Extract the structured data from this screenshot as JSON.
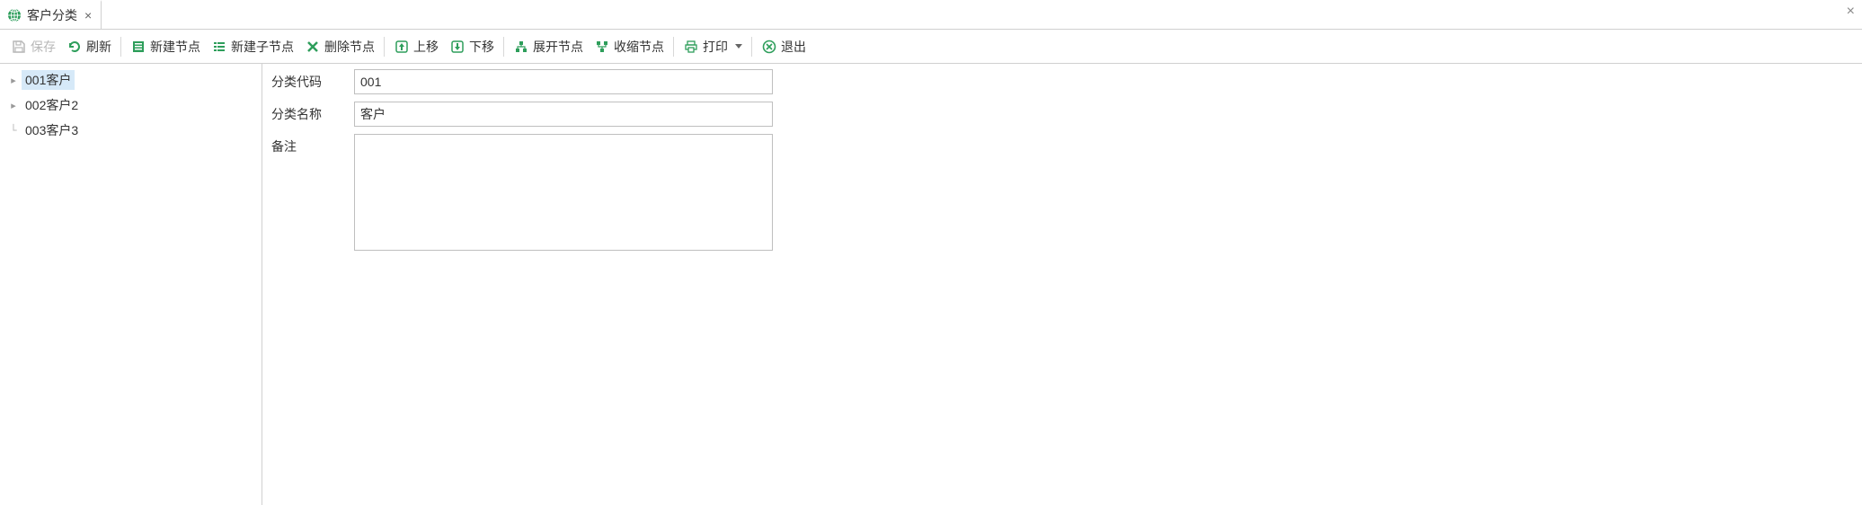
{
  "tab": {
    "title": "客户分类"
  },
  "toolbar": {
    "save": "保存",
    "refresh": "刷新",
    "new_node": "新建节点",
    "new_child_node": "新建子节点",
    "delete_node": "删除节点",
    "move_up": "上移",
    "move_down": "下移",
    "expand_node": "展开节点",
    "collapse_node": "收缩节点",
    "print": "打印",
    "exit": "退出"
  },
  "tree": {
    "items": [
      {
        "label": "001客户",
        "expandable": true,
        "selected": true
      },
      {
        "label": "002客户2",
        "expandable": true,
        "selected": false
      },
      {
        "label": "003客户3",
        "expandable": false,
        "selected": false
      }
    ]
  },
  "form": {
    "code_label": "分类代码",
    "code_value": "001",
    "name_label": "分类名称",
    "name_value": "客户",
    "remark_label": "备注",
    "remark_value": ""
  },
  "colors": {
    "green": "#2e9e5b",
    "tab_icon": "#2e9e5b",
    "disabled": "#b8b8b8",
    "selected_bg": "#d6e9f8"
  }
}
